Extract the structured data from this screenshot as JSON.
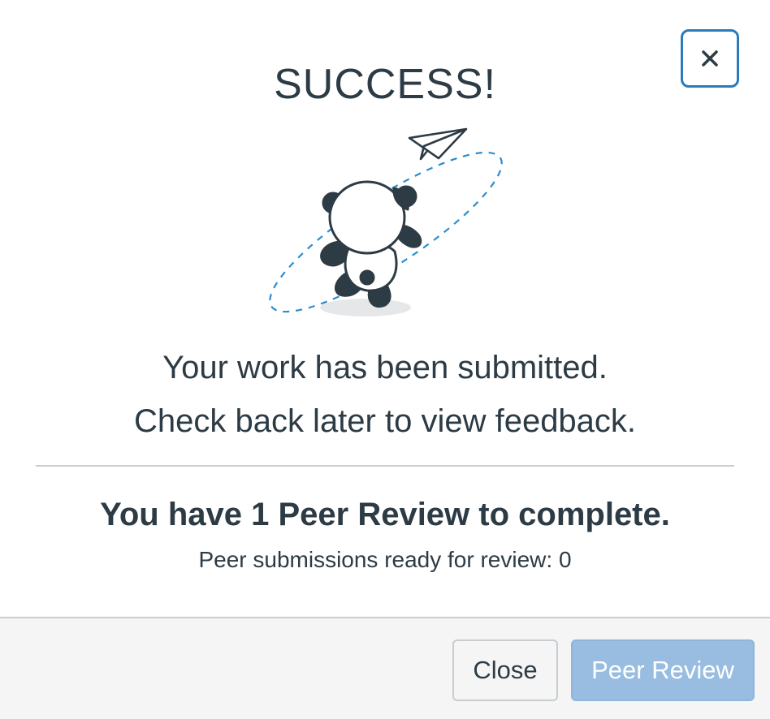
{
  "dialog": {
    "title": "SUCCESS!",
    "message_line1": "Your work has been submitted.",
    "message_line2": "Check back later to view feedback.",
    "peer_heading": "You have 1 Peer Review to complete.",
    "peer_status": "Peer submissions ready for review: 0",
    "illustration_icon": "panda-paper-plane-icon",
    "close_icon": "close-icon"
  },
  "footer": {
    "close_label": "Close",
    "peer_review_label": "Peer Review",
    "peer_review_disabled": true
  },
  "colors": {
    "text": "#2d3b45",
    "focus_border": "#2b7abc",
    "primary_disabled": "#98bde0",
    "divider": "#c7cdd1",
    "footer_bg": "#f5f5f5",
    "dash": "#2b8ccf"
  }
}
